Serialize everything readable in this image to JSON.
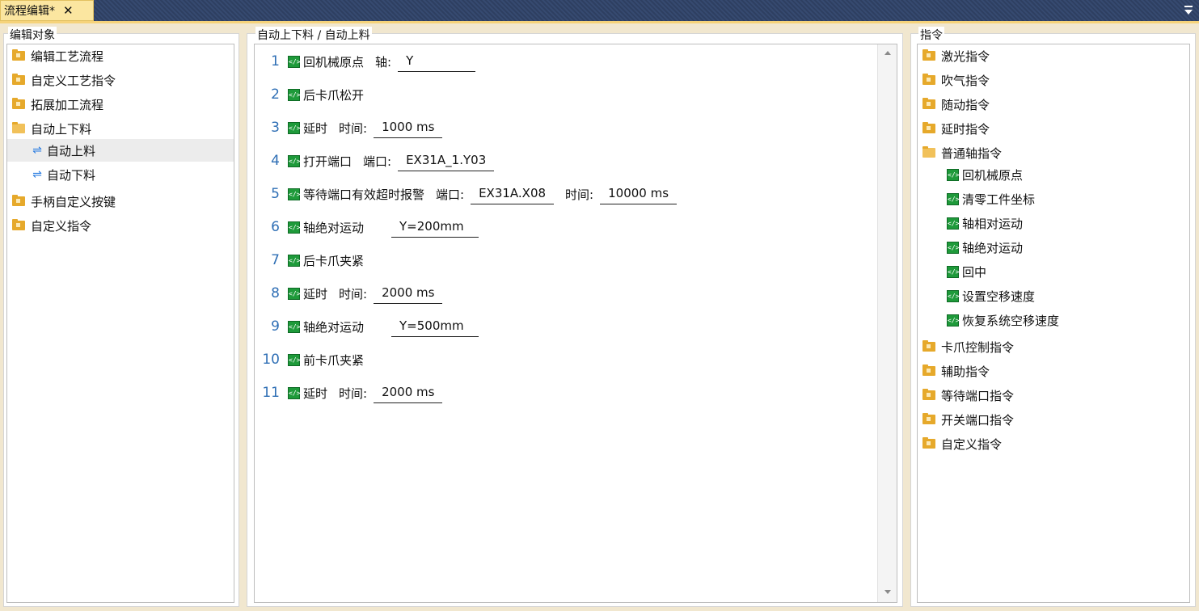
{
  "tab": {
    "title": "流程编辑*",
    "close": "✕"
  },
  "left": {
    "title": "编辑对象",
    "items": [
      {
        "label": "编辑工艺流程",
        "type": "folder"
      },
      {
        "label": "自定义工艺指令",
        "type": "folder"
      },
      {
        "label": "拓展加工流程",
        "type": "folder"
      },
      {
        "label": "自动上下料",
        "type": "folder-open"
      },
      {
        "label": "自动上料",
        "type": "flow",
        "selected": true
      },
      {
        "label": "自动下料",
        "type": "flow"
      },
      {
        "label": "手柄自定义按键",
        "type": "folder"
      },
      {
        "label": "自定义指令",
        "type": "folder"
      }
    ]
  },
  "middle": {
    "title": "自动上下料 / 自动上料",
    "lines": [
      {
        "num": "1",
        "cmd": "回机械原点",
        "params": [
          {
            "label": "轴:",
            "value": "Y"
          }
        ]
      },
      {
        "num": "2",
        "cmd": "后卡爪松开",
        "params": []
      },
      {
        "num": "3",
        "cmd": "延时",
        "params": [
          {
            "label": "时间:",
            "value": "1000 ms"
          }
        ]
      },
      {
        "num": "4",
        "cmd": "打开端口",
        "params": [
          {
            "label": "端口:",
            "value": "EX31A_1.Y03"
          }
        ]
      },
      {
        "num": "5",
        "cmd": "等待端口有效超时报警",
        "params": [
          {
            "label": "端口:",
            "value": "EX31A.X08"
          },
          {
            "label": "时间:",
            "value": "10000 ms"
          }
        ]
      },
      {
        "num": "6",
        "cmd": "轴绝对运动",
        "params": [
          {
            "label": "",
            "value": "Y=200mm"
          }
        ]
      },
      {
        "num": "7",
        "cmd": "后卡爪夹紧",
        "params": []
      },
      {
        "num": "8",
        "cmd": "延时",
        "params": [
          {
            "label": "时间:",
            "value": "2000 ms"
          }
        ]
      },
      {
        "num": "9",
        "cmd": "轴绝对运动",
        "params": [
          {
            "label": "",
            "value": "Y=500mm"
          }
        ]
      },
      {
        "num": "10",
        "cmd": "前卡爪夹紧",
        "params": []
      },
      {
        "num": "11",
        "cmd": "延时",
        "params": [
          {
            "label": "时间:",
            "value": "2000 ms"
          }
        ]
      }
    ]
  },
  "right": {
    "title": "指令",
    "items": [
      {
        "label": "激光指令",
        "type": "folder"
      },
      {
        "label": "吹气指令",
        "type": "folder"
      },
      {
        "label": "随动指令",
        "type": "folder"
      },
      {
        "label": "延时指令",
        "type": "folder"
      },
      {
        "label": "普通轴指令",
        "type": "folder-open"
      },
      {
        "label": "回机械原点",
        "type": "cmd"
      },
      {
        "label": "清零工件坐标",
        "type": "cmd"
      },
      {
        "label": "轴相对运动",
        "type": "cmd"
      },
      {
        "label": "轴绝对运动",
        "type": "cmd"
      },
      {
        "label": "回中",
        "type": "cmd"
      },
      {
        "label": "设置空移速度",
        "type": "cmd"
      },
      {
        "label": "恢复系统空移速度",
        "type": "cmd"
      },
      {
        "label": "卡爪控制指令",
        "type": "folder"
      },
      {
        "label": "辅助指令",
        "type": "folder"
      },
      {
        "label": "等待端口指令",
        "type": "folder"
      },
      {
        "label": "开关端口指令",
        "type": "folder"
      },
      {
        "label": "自定义指令",
        "type": "folder"
      }
    ]
  },
  "colors": {
    "accent_tab": "#fbe6a0",
    "folder": "#e6a92b",
    "cmd_icon": "#1e9a3a",
    "line_number": "#2f6fb5"
  }
}
